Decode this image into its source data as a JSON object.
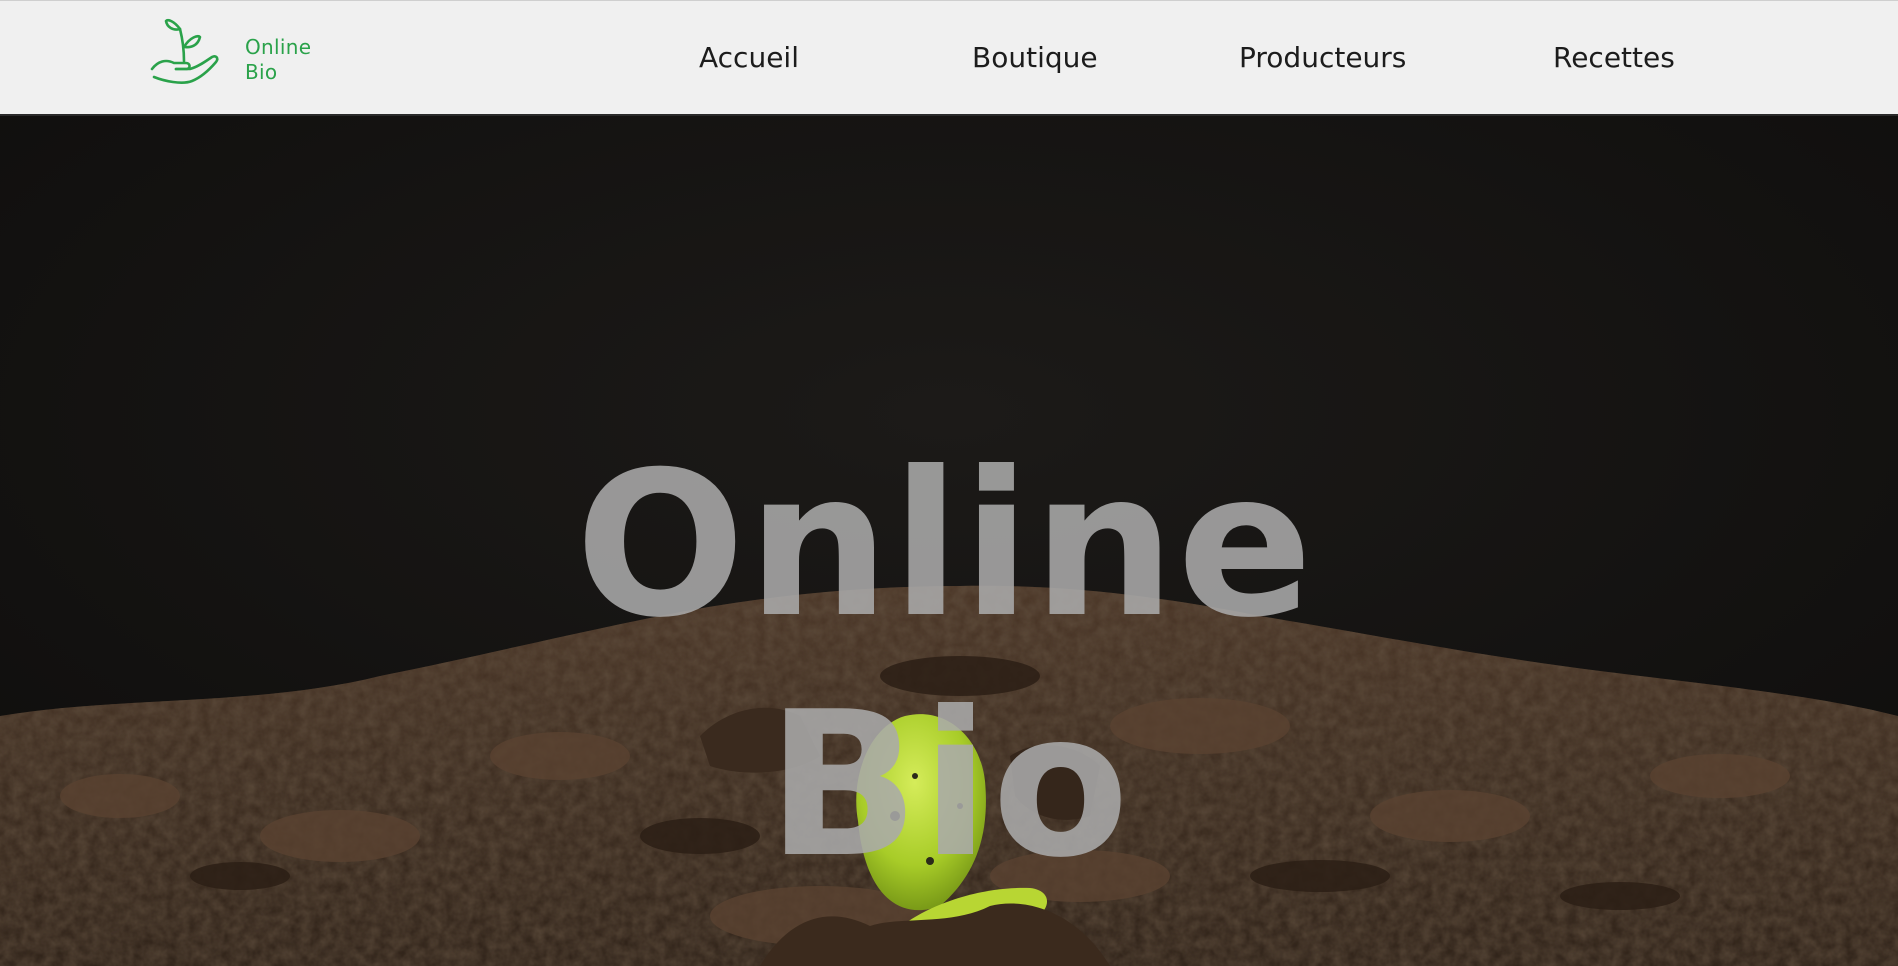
{
  "header": {
    "brand_line1": "Online",
    "brand_line2": "Bio",
    "logo_icon": "sprout-in-hand-icon",
    "brand_color": "#2aa24a"
  },
  "nav": {
    "items": [
      {
        "label": "Accueil"
      },
      {
        "label": "Boutique"
      },
      {
        "label": "Producteurs"
      },
      {
        "label": "Recettes"
      }
    ]
  },
  "hero": {
    "title_line1": "Online",
    "title_line2": "Bio",
    "background": "sprout emerging from soil"
  }
}
